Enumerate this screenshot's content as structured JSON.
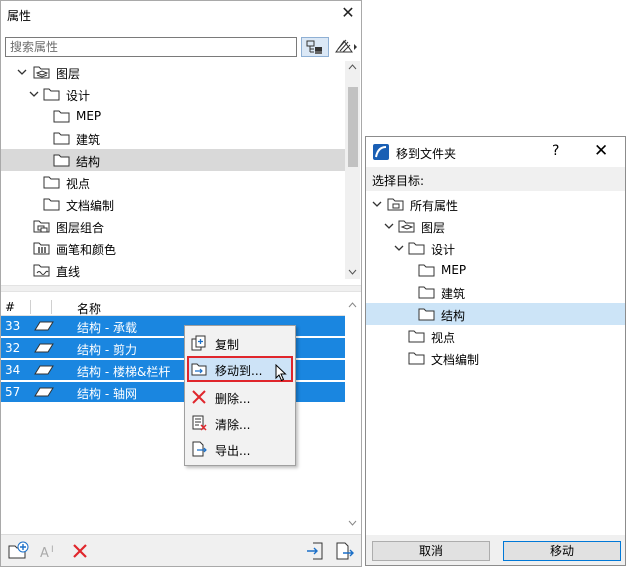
{
  "left_panel": {
    "title": "属性",
    "search_placeholder": "搜索属性",
    "tree": [
      {
        "label": "图层",
        "expanded": true,
        "level": 1,
        "icon": "layers-folder-icon"
      },
      {
        "label": "设计",
        "expanded": true,
        "level": 2,
        "icon": "folder-icon"
      },
      {
        "label": "MEP",
        "level": 3,
        "icon": "folder-icon"
      },
      {
        "label": "建筑",
        "level": 3,
        "icon": "folder-icon"
      },
      {
        "label": "结构",
        "level": 3,
        "icon": "folder-icon",
        "selected": true
      },
      {
        "label": "视点",
        "level": 2,
        "icon": "folder-icon"
      },
      {
        "label": "文档编制",
        "level": 2,
        "icon": "folder-icon"
      },
      {
        "label": "图层组合",
        "level": 1,
        "icon": "layer-combination-icon"
      },
      {
        "label": "画笔和颜色",
        "level": 1,
        "icon": "pen-color-icon"
      },
      {
        "label": "直线",
        "level": 1,
        "icon": "line-type-icon"
      }
    ],
    "list_header": {
      "num": "#",
      "name": "名称"
    },
    "list_rows": [
      {
        "num": "33",
        "name": "结构 - 承载"
      },
      {
        "num": "32",
        "name": "结构 - 剪力"
      },
      {
        "num": "34",
        "name": "结构 - 楼梯&栏杆"
      },
      {
        "num": "57",
        "name": "结构 - 轴网"
      }
    ]
  },
  "context_menu": {
    "items": [
      {
        "label": "复制",
        "icon": "duplicate-icon"
      },
      {
        "label": "移动到...",
        "icon": "move-to-folder-icon",
        "highlighted": true
      },
      {
        "label": "删除...",
        "icon": "delete-x-icon"
      },
      {
        "label": "清除...",
        "icon": "purge-icon"
      },
      {
        "label": "导出...",
        "icon": "export-icon"
      }
    ]
  },
  "dialog": {
    "title": "移到文件夹",
    "help": "?",
    "prompt": "选择目标:",
    "tree": [
      {
        "label": "所有属性",
        "level": 0,
        "expanded": true
      },
      {
        "label": "图层",
        "level": 1,
        "expanded": true
      },
      {
        "label": "设计",
        "level": 2,
        "expanded": true
      },
      {
        "label": "MEP",
        "level": 3
      },
      {
        "label": "建筑",
        "level": 3
      },
      {
        "label": "结构",
        "level": 3,
        "selected": true
      },
      {
        "label": "视点",
        "level": 2
      },
      {
        "label": "文档编制",
        "level": 2
      }
    ],
    "cancel_label": "取消",
    "ok_label": "移动"
  },
  "colors": {
    "selection_blue": "#1a86e0",
    "menu_highlight": "#cde3f7",
    "highlight_border": "#e0262c",
    "delete_red": "#e0262c",
    "dialog_selection": "#cce4f7"
  }
}
